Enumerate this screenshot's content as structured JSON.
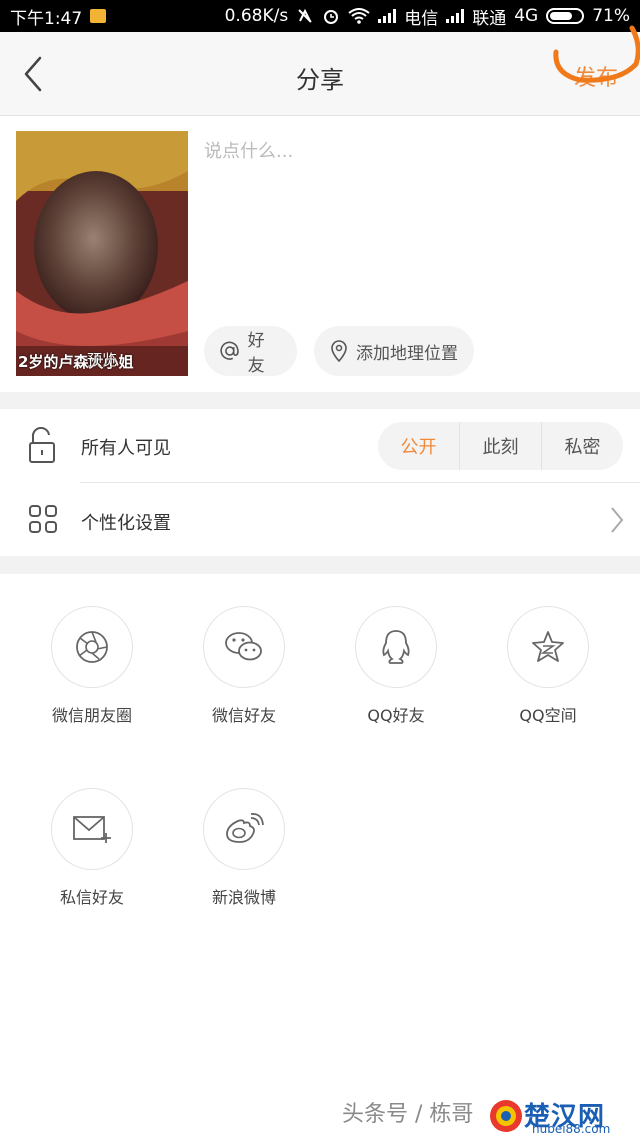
{
  "status_bar": {
    "time": "下午1:47",
    "speed": "0.68K/s",
    "carrier1": "电信",
    "carrier2": "联通",
    "network": "4G",
    "battery": "71%",
    "battery_level": 0.71
  },
  "header": {
    "title": "分享",
    "publish_label": "发布"
  },
  "compose": {
    "placeholder": "说点什么...",
    "thumbnail_caption": "2岁的卢森大小姐",
    "preview_label": "预览",
    "friends_chip": "好友",
    "location_chip": "添加地理位置"
  },
  "visibility": {
    "label": "所有人可见",
    "options": [
      "公开",
      "此刻",
      "私密"
    ],
    "selected": "公开"
  },
  "custom_settings": {
    "label": "个性化设置"
  },
  "share_targets": [
    {
      "label": "微信朋友圈",
      "icon": "wechat-moments-icon"
    },
    {
      "label": "微信好友",
      "icon": "wechat-icon"
    },
    {
      "label": "QQ好友",
      "icon": "qq-icon"
    },
    {
      "label": "QQ空间",
      "icon": "qzone-icon"
    },
    {
      "label": "私信好友",
      "icon": "private-message-icon"
    },
    {
      "label": "新浪微博",
      "icon": "weibo-icon"
    }
  ],
  "watermark": {
    "text": "头条号 / 栋哥",
    "site_name": "楚汉网",
    "site_domain": "hubei88.com"
  },
  "colors": {
    "accent": "#f08a3a",
    "band": "#f2f2f2",
    "header_bg": "#f7f7f7"
  }
}
